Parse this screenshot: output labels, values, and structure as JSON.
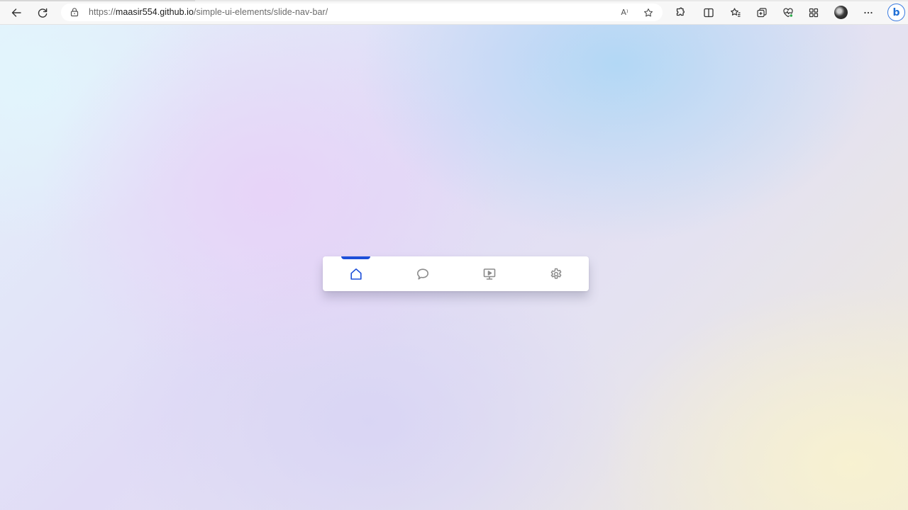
{
  "browser": {
    "url_scheme": "https://",
    "url_host": "maasir554.github.io",
    "url_path": "/simple-ui-elements/slide-nav-bar/",
    "read_aloud_glyph": "A⁾",
    "bing_glyph": "b",
    "icons": {
      "back": "back-arrow-icon",
      "refresh": "refresh-icon",
      "lock": "lock-icon",
      "favorite": "star-icon",
      "extensions": "puzzle-icon",
      "split_screen": "split-screen-icon",
      "favorites": "favorites-list-icon",
      "collections": "collections-icon",
      "performance": "heart-pulse-icon",
      "apps": "apps-grid-icon",
      "profile": "avatar",
      "more": "more-dots-icon",
      "copilot": "bing-icon"
    }
  },
  "nav_bar": {
    "active_color": "#1d4fd9",
    "inactive_color": "#8c8c8c",
    "active_index": 0,
    "items": [
      {
        "name": "home",
        "icon": "home-icon"
      },
      {
        "name": "chat",
        "icon": "chat-bubble-icon"
      },
      {
        "name": "presentation",
        "icon": "monitor-play-icon"
      },
      {
        "name": "settings",
        "icon": "gear-icon"
      }
    ]
  }
}
